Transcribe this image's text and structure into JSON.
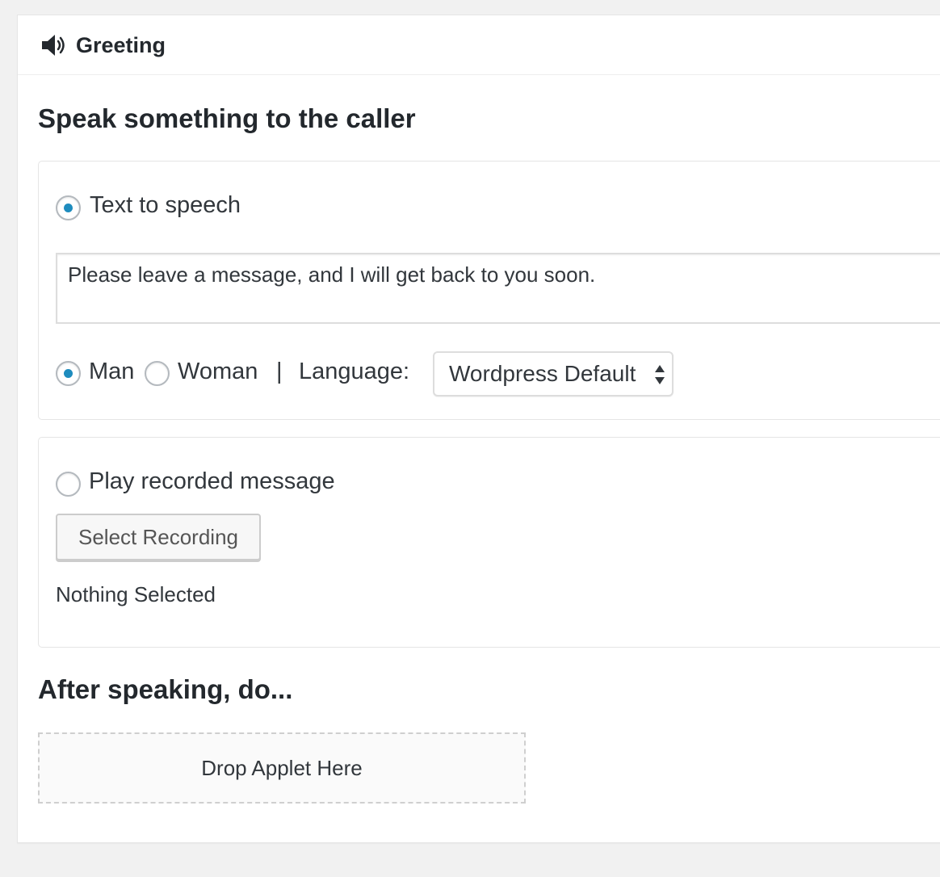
{
  "header": {
    "icon": "speaker-icon",
    "title": "Greeting"
  },
  "heading_speak": "Speak something to the caller",
  "tts": {
    "option_label": "Text to speech",
    "selected": true,
    "message": "Please leave a message, and I will get back to you soon.",
    "voice": {
      "man_label": "Man",
      "woman_label": "Woman",
      "selected": "Man",
      "separator": "|",
      "language_label": "Language:",
      "language_value": "Wordpress Default"
    }
  },
  "recorded": {
    "option_label": "Play recorded message",
    "selected": false,
    "button_label": "Select Recording",
    "status": "Nothing Selected"
  },
  "heading_after": "After speaking, do...",
  "dropzone_label": "Drop Applet Here",
  "colors": {
    "accent": "#1e8cbe",
    "background": "#f1f1f1",
    "panel": "#ffffff"
  }
}
